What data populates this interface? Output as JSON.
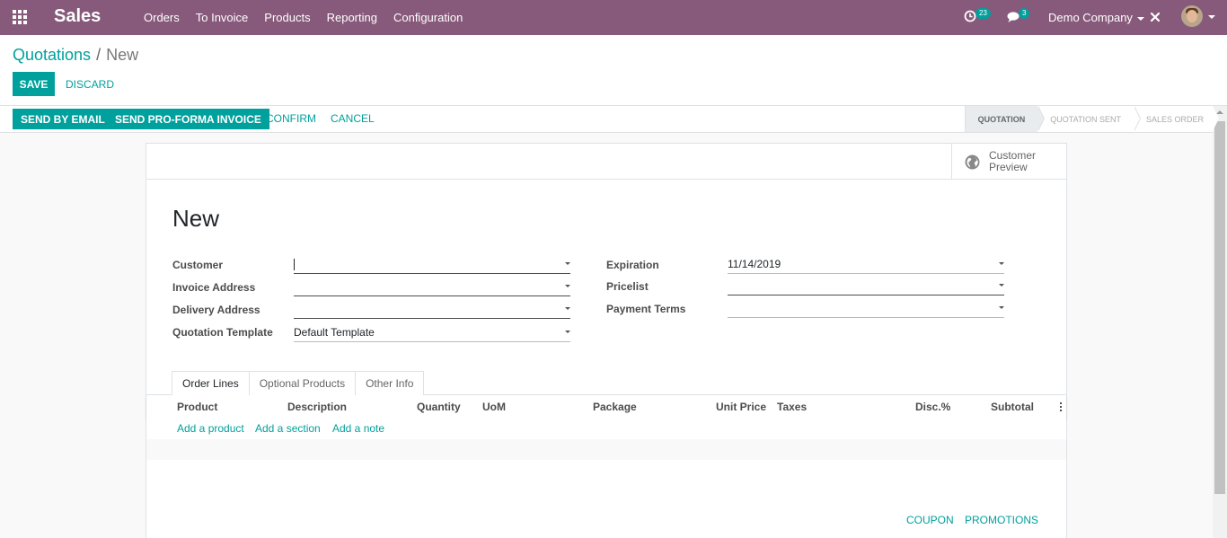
{
  "navbar": {
    "app_name": "Sales",
    "menu": [
      "Orders",
      "To Invoice",
      "Products",
      "Reporting",
      "Configuration"
    ],
    "activity_count": "23",
    "message_count": "3",
    "company": "Demo Company",
    "color": "#875a7b"
  },
  "control_panel": {
    "breadcrumb_parent": "Quotations",
    "breadcrumb_separator": "/",
    "breadcrumb_current": "New",
    "save_label": "SAVE",
    "discard_label": "DISCARD"
  },
  "statusbar": {
    "send_email_label": "SEND BY EMAIL",
    "send_proforma_label": "SEND PRO-FORMA INVOICE",
    "confirm_label": "CONFIRM",
    "cancel_label": "CANCEL",
    "stages": [
      {
        "label": "QUOTATION",
        "active": true
      },
      {
        "label": "QUOTATION SENT",
        "active": false
      },
      {
        "label": "SALES ORDER",
        "active": false
      }
    ]
  },
  "sheet": {
    "customer_preview_line1": "Customer",
    "customer_preview_line2": "Preview",
    "title": "New",
    "left_fields": [
      {
        "label": "Customer",
        "value": ""
      },
      {
        "label": "Invoice Address",
        "value": ""
      },
      {
        "label": "Delivery Address",
        "value": ""
      },
      {
        "label": "Quotation Template",
        "value": "Default Template"
      }
    ],
    "right_fields": [
      {
        "label": "Expiration",
        "value": "11/14/2019"
      },
      {
        "label": "Pricelist",
        "value": ""
      },
      {
        "label": "Payment Terms",
        "value": ""
      }
    ],
    "tabs": [
      "Order Lines",
      "Optional Products",
      "Other Info"
    ],
    "columns": [
      "Product",
      "Description",
      "Quantity",
      "UoM",
      "Package",
      "Unit Price",
      "Taxes",
      "Disc.%",
      "Subtotal"
    ],
    "add_links": [
      "Add a product",
      "Add a section",
      "Add a note"
    ],
    "coupon_label": "COUPON",
    "promotions_label": "PROMOTIONS"
  },
  "colors": {
    "accent": "#00a09d",
    "navbar": "#875a7b"
  }
}
